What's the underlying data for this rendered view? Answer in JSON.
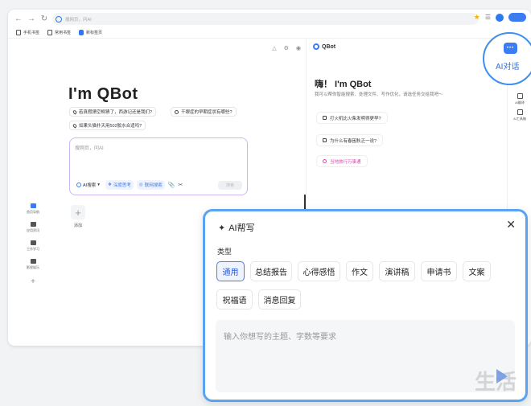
{
  "browser": {
    "url_placeholder": "搜网页，问AI",
    "bookmarks": [
      "手机书签",
      "常用书签",
      "新标签页"
    ]
  },
  "home": {
    "title": "I'm QBot",
    "chips": [
      "若真假猜空柳猜了，西游记还是我们?",
      "干眼症的早期症状有哪些?",
      "如果头猫扑天用502胶水合适吗?"
    ],
    "search_placeholder": "搜网页，问AI",
    "tools": {
      "ai_search": "AI搜索",
      "deep_think": "深度思考",
      "web_search": "联网搜索",
      "send": "搜索"
    },
    "side_nav": [
      "首页导航",
      "应用资讯",
      "工作学习",
      "影视娱乐"
    ],
    "add_label": "添加"
  },
  "qbot_panel": {
    "header": "QBot",
    "greeting": "嗨！ I'm QBot",
    "subtitle": "我可以帮你智能搜索、处理文件、写作优化，请选任务交给我吧～",
    "suggestions": [
      "打火机比火柴发明得更早?",
      "为什么有春困秋乏一说?",
      "当地旅行万事通"
    ]
  },
  "right_rail": [
    "AI翻译",
    "AI工具箱"
  ],
  "ai_chat_bubble": {
    "label": "AI对话"
  },
  "dialog": {
    "title": "AI帮写",
    "type_label": "类型",
    "tags": [
      "通用",
      "总结报告",
      "心得感悟",
      "作文",
      "演讲稿",
      "申请书",
      "文案",
      "祝福语",
      "消息回复"
    ],
    "active_tag": "通用",
    "input_placeholder": "输入你想写的主题、字数等要求"
  },
  "watermark": "生活"
}
